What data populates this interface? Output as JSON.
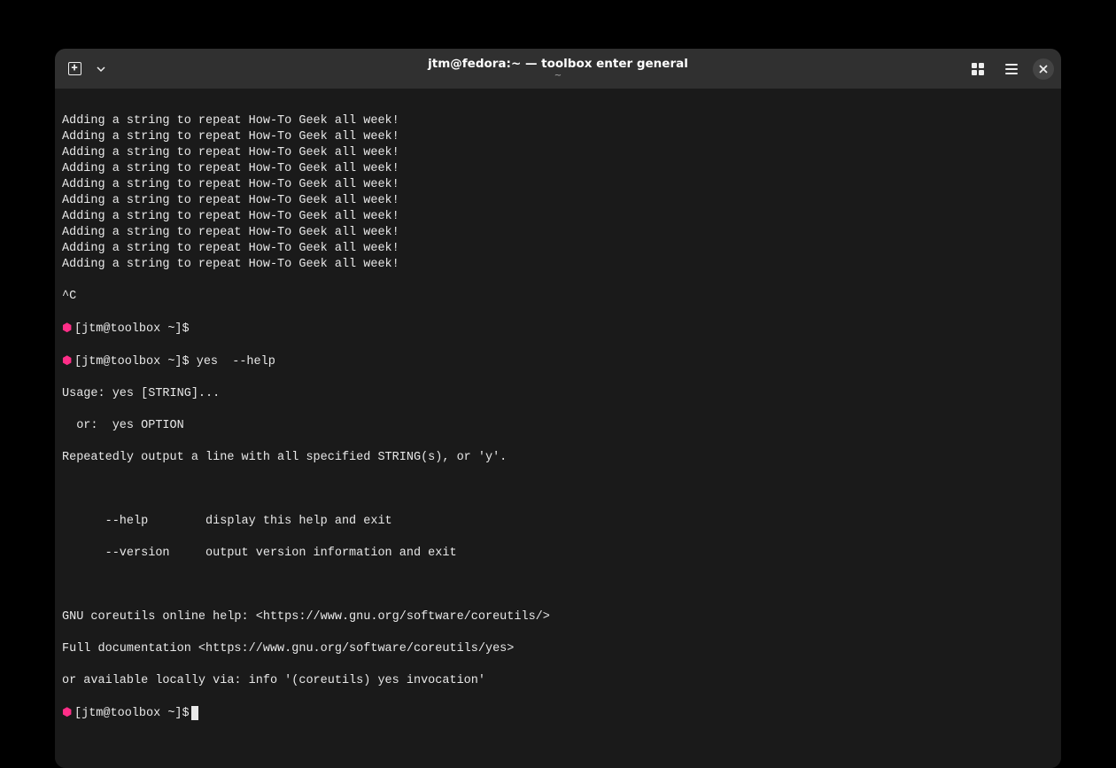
{
  "window": {
    "title": "jtm@fedora:~ — toolbox enter general",
    "subtitle": "~"
  },
  "prompt": {
    "marker": "⬢",
    "text": "[jtm@toolbox ~]$"
  },
  "repeat_line": "Adding a string to repeat How-To Geek all week!",
  "repeat_count": 10,
  "interrupt": "^C",
  "command2": " yes  --help",
  "help_output": {
    "l1": "Usage: yes [STRING]...",
    "l2": "  or:  yes OPTION",
    "l3": "Repeatedly output a line with all specified STRING(s), or 'y'.",
    "l4": "      --help        display this help and exit",
    "l5": "      --version     output version information and exit",
    "l6": "GNU coreutils online help: <https://www.gnu.org/software/coreutils/>",
    "l7": "Full documentation <https://www.gnu.org/software/coreutils/yes>",
    "l8": "or available locally via: info '(coreutils) yes invocation'"
  }
}
